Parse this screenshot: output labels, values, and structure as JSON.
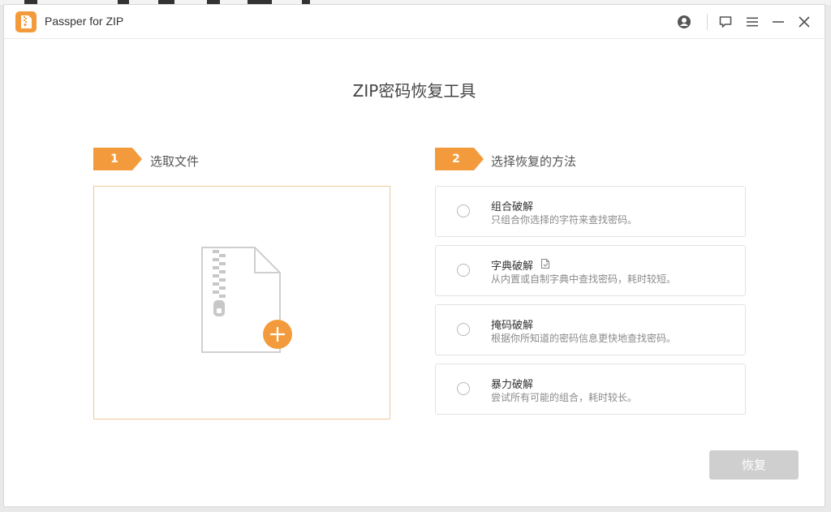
{
  "window": {
    "app_title": "Passper for ZIP"
  },
  "main": {
    "title": "ZIP密码恢复工具"
  },
  "steps": [
    {
      "number": "1",
      "label": "选取文件"
    },
    {
      "number": "2",
      "label": "选择恢复的方法"
    }
  ],
  "methods": [
    {
      "title": "组合破解",
      "desc": "只组合你选择的字符来查找密码。",
      "has_info_icon": false
    },
    {
      "title": "字典破解",
      "desc": "从内置或自制字典中查找密码，耗时较短。",
      "has_info_icon": true
    },
    {
      "title": "掩码破解",
      "desc": "根据你所知道的密码信息更快地查找密码。",
      "has_info_icon": false
    },
    {
      "title": "暴力破解",
      "desc": "尝试所有可能的组合，耗时较长。",
      "has_info_icon": false
    }
  ],
  "actions": {
    "recover_label": "恢复"
  },
  "icons": {
    "logo": "zip-file-icon",
    "account": "account-icon",
    "feedback": "feedback-icon",
    "menu": "menu-icon",
    "minimize": "minimize-icon",
    "close": "close-icon",
    "add_file": "add-file-icon"
  },
  "colors": {
    "accent": "#f39b3c",
    "disabled_button": "#cfcfcf"
  }
}
